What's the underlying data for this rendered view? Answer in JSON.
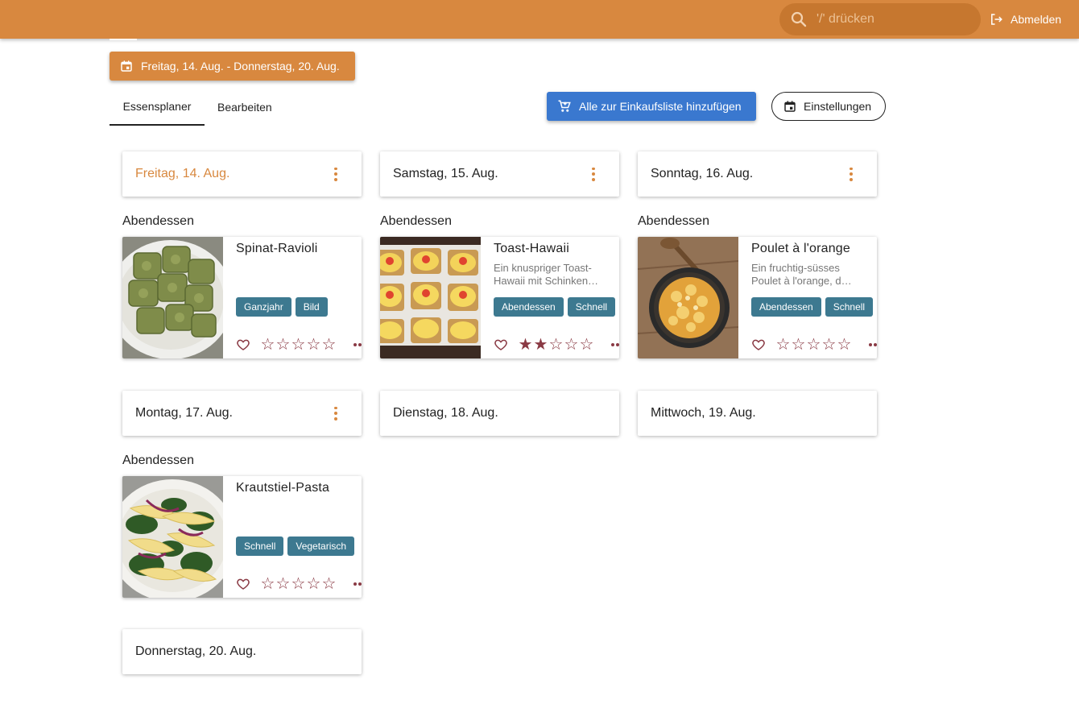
{
  "topbar": {
    "search_placeholder": "'/' drücken",
    "logout_label": "Abmelden"
  },
  "date_range": {
    "label": "Freitag, 14. Aug. - Donnerstag, 20. Aug."
  },
  "tabs": [
    {
      "label": "Essensplaner",
      "active": true
    },
    {
      "label": "Bearbeiten",
      "active": false
    }
  ],
  "actions": {
    "add_all_label": "Alle zur Einkaufsliste hinzufügen",
    "settings_label": "Einstellungen"
  },
  "days": [
    {
      "label": "Freitag, 14. Aug.",
      "today": true
    },
    {
      "label": "Samstag, 15. Aug."
    },
    {
      "label": "Sonntag, 16. Aug."
    },
    {
      "label": "Montag, 17. Aug."
    },
    {
      "label": "Dienstag, 18. Aug."
    },
    {
      "label": "Mittwoch, 19. Aug."
    },
    {
      "label": "Donnerstag, 20. Aug."
    }
  ],
  "meals": [
    {
      "category": "Abendessen",
      "title": "Spinat-Ravioli",
      "description_lines": [],
      "tags": [
        "Ganzjahr",
        "Bild"
      ],
      "rating": 0
    },
    {
      "category": "Abendessen",
      "title": "Toast-Hawaii",
      "description_lines": [
        "Ein knuspriger Toast-",
        "Hawaii mit Schinken…"
      ],
      "tags": [
        "Abendessen",
        "Schnell"
      ],
      "rating": 2
    },
    {
      "category": "Abendessen",
      "title": "Poulet à l'orange",
      "description_lines": [
        "Ein fruchtig-süsses",
        "Poulet à l'orange, d…"
      ],
      "tags": [
        "Abendessen",
        "Schnell"
      ],
      "rating": 0
    },
    {
      "category": "Abendessen",
      "title": "Krautstiel-Pasta",
      "description_lines": [],
      "tags": [
        "Schnell",
        "Vegetarisch"
      ],
      "rating": 0
    }
  ],
  "colors": {
    "primary": "#d8883f",
    "accent_blue": "#3a78cf",
    "tag": "#3d7990",
    "rating": "#8a3a44"
  }
}
